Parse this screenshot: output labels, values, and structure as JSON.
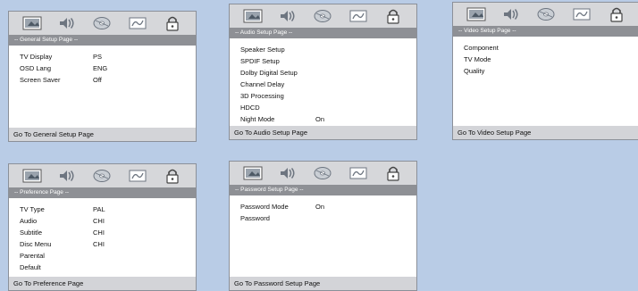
{
  "panels": [
    {
      "id": "general",
      "header": "-- General Setup Page --",
      "footer": "Go To General Setup Page",
      "rows": [
        {
          "label": "TV Display",
          "value": "PS"
        },
        {
          "label": "OSD Lang",
          "value": "ENG"
        },
        {
          "label": "Screen Saver",
          "value": "Off"
        }
      ]
    },
    {
      "id": "audio",
      "header": "-- Audio Setup Page --",
      "footer": "Go To Audio Setup Page",
      "rows": [
        {
          "label": "Speaker Setup",
          "value": ""
        },
        {
          "label": "SPDIF Setup",
          "value": ""
        },
        {
          "label": "Dolby Digital Setup",
          "value": ""
        },
        {
          "label": "Channel Delay",
          "value": ""
        },
        {
          "label": "3D Processing",
          "value": ""
        },
        {
          "label": "HDCD",
          "value": ""
        },
        {
          "label": "Night Mode",
          "value": "On"
        }
      ]
    },
    {
      "id": "video",
      "header": "-- Video Setup Page --",
      "footer": "Go To Video Setup Page",
      "rows": [
        {
          "label": "Component",
          "value": ""
        },
        {
          "label": "TV Mode",
          "value": ""
        },
        {
          "label": "Quality",
          "value": ""
        }
      ]
    },
    {
      "id": "preference",
      "header": "-- Preference Page --",
      "footer": "Go To Preference Page",
      "rows": [
        {
          "label": "TV Type",
          "value": "PAL"
        },
        {
          "label": "Audio",
          "value": "CHI"
        },
        {
          "label": "Subtitle",
          "value": "CHI"
        },
        {
          "label": "Disc Menu",
          "value": "CHI"
        },
        {
          "label": "Parental",
          "value": ""
        },
        {
          "label": "Default",
          "value": ""
        }
      ]
    },
    {
      "id": "password",
      "header": "-- Password Setup Page --",
      "footer": "Go To Password Setup Page",
      "rows": [
        {
          "label": "Password Mode",
          "value": "On"
        },
        {
          "label": "Password",
          "value": ""
        }
      ]
    }
  ],
  "icons": [
    "tv-display-icon",
    "speaker-icon",
    "disc-icon",
    "preference-icon",
    "lock-icon"
  ],
  "colors": {
    "background": "#b9cce6",
    "header_bar": "#8e9095",
    "icon_bar": "#d6d7da",
    "footer_bar": "#d3d4d8"
  }
}
